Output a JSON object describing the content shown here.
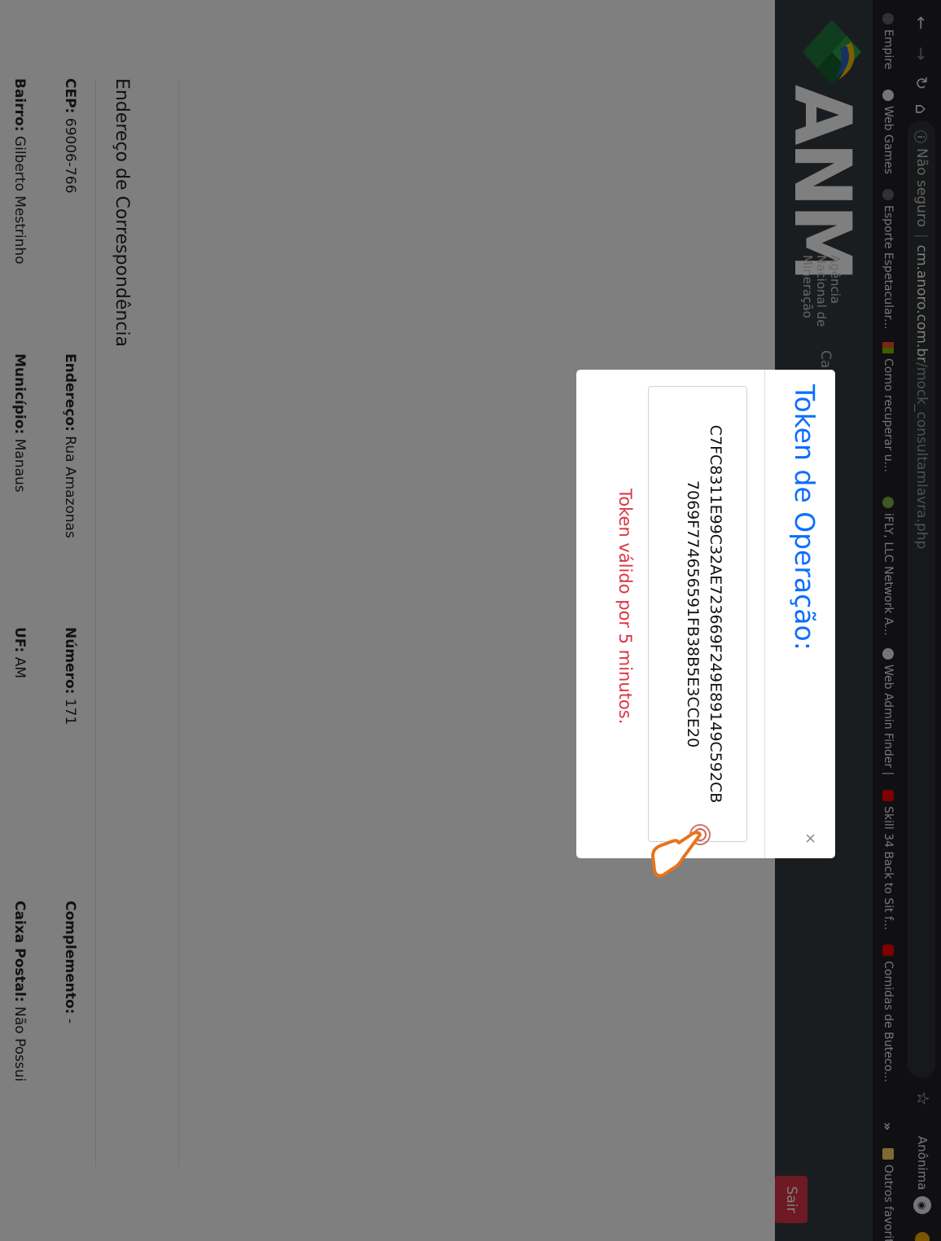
{
  "browser": {
    "address": {
      "security": "Não seguro",
      "host": "cm.anoro.com.br",
      "path": "/mock_consultamlavra.php"
    },
    "profile_label": "Anônima",
    "bookmarks": [
      {
        "label": "Empire"
      },
      {
        "label": "Web Games"
      },
      {
        "label": "Esporte Espetacular..."
      },
      {
        "label": "Como recuperar u..."
      },
      {
        "label": "iFLY, LLC Network A..."
      },
      {
        "label": "Web Admin Finder |"
      },
      {
        "label": "Skill 34 Back to Sit f..."
      },
      {
        "label": "Comidas de Buteco..."
      }
    ],
    "bookmarks_more": "»",
    "other_favorites": "Outros favoritos"
  },
  "header": {
    "logo_text": "ANM",
    "logo_sub": [
      "Agência",
      "Nacional de",
      "Mineração"
    ],
    "nav_partial": "Ca",
    "logout_label": "Sair"
  },
  "section": {
    "title": "Endereço de Correspondência",
    "fields": {
      "cep": {
        "label": "CEP:",
        "value": "69006-766"
      },
      "endereco": {
        "label": "Endereço:",
        "value": "Rua Amazonas"
      },
      "numero": {
        "label": "Número:",
        "value": "171"
      },
      "complemento": {
        "label": "Complemento:",
        "value": "-"
      },
      "bairro": {
        "label": "Bairro:",
        "value": "Gilberto Mestrinho"
      },
      "municipio": {
        "label": "Município:",
        "value": "Manaus"
      },
      "uf": {
        "label": "UF:",
        "value": "AM"
      },
      "caixa_postal": {
        "label": "Caixa Postal:",
        "value": "Não Possui"
      }
    }
  },
  "modal": {
    "title": "Token de Operação:",
    "close": "×",
    "token_line1": "C7FC8311E99C32AE723669F249E89149C592CB",
    "token_line2": "7069F774656591FB38B5E3CCE20",
    "validity": "Token válido por 5 minutos."
  },
  "colors": {
    "accent": "#0d6efd",
    "danger": "#dc3545",
    "header_bg": "#343a40"
  }
}
